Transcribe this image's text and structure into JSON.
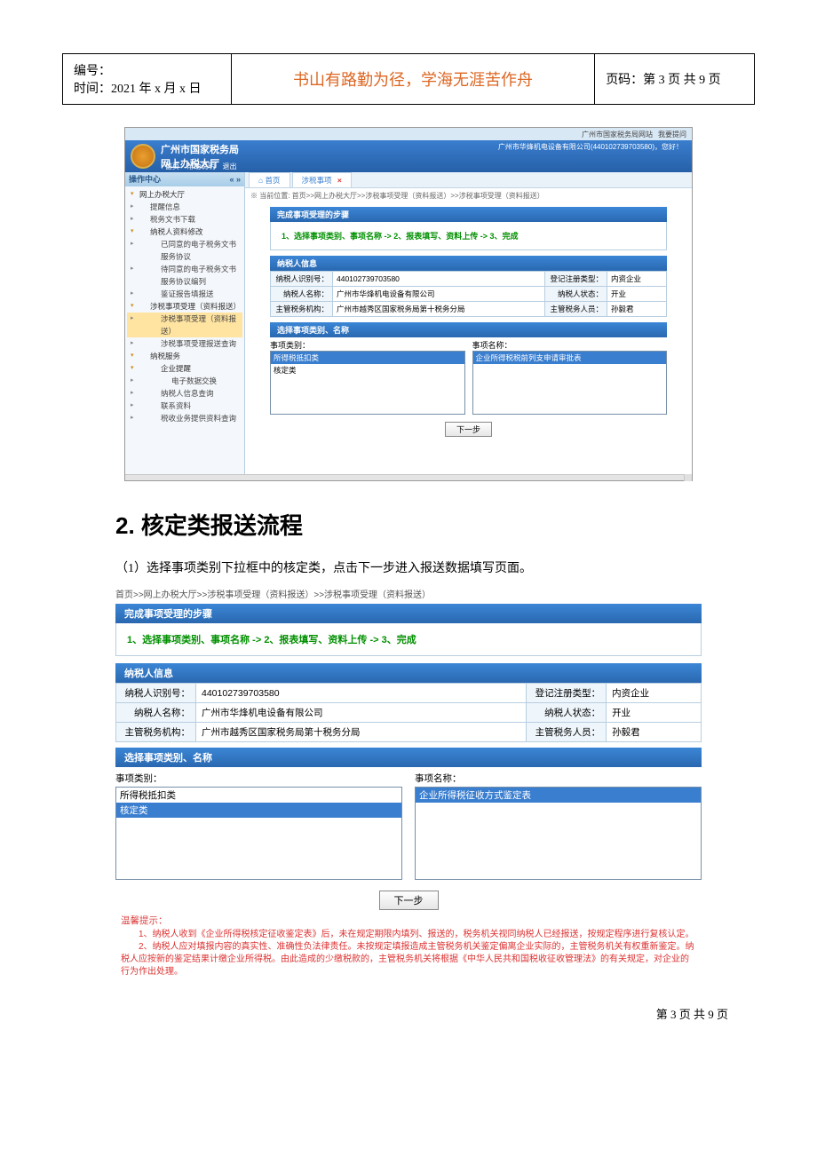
{
  "header": {
    "left_l1": "编号：",
    "left_l2": "时间：2021 年 x 月 x 日",
    "mid": "书山有路勤为径，学海无涯苦作舟",
    "right": "页码：第 3 页  共 9 页"
  },
  "emb": {
    "topbar_link1": "广州市国家税务局网站",
    "topbar_link2": "我要提问",
    "title": "广州市国家税务局",
    "subtitle": "网上办税大厅",
    "userline": "广州市华烽机电设备有限公司(440102739703580)，您好！",
    "nav_home": "首页",
    "nav_fav": "帮助说明",
    "nav_exit": "退出",
    "left_hd": "操作中心",
    "tree": [
      "网上办税大厅",
      "提醒信息",
      "税务文书下载",
      "纳税人资料修改",
      "已同意的电子税务文书服务协议",
      "待同意的电子税务文书服务协议编列",
      "鉴证报告填报送",
      "涉税事项受理（资料报送）",
      "涉税事项受理（资料报送）",
      "涉税事项受理报送查询",
      "纳税服务",
      "企业提醒",
      "电子数据交换",
      "纳税人信息查询",
      "联系资料",
      "税收业务提供资料查询"
    ],
    "tab_home": "首页",
    "tab_active": "涉税事项",
    "crumb": "※ 当前位置: 首页>>网上办税大厅>>涉税事项受理（资料报送）>>涉税事项受理（资料报送）",
    "step_hd": "完成事项受理的步骤",
    "steps": "1、选择事项类别、事项名称  ->  2、报表填写、资料上传  ->  3、完成",
    "info_hd": "纳税人信息",
    "info": {
      "id_lbl": "纳税人识别号：",
      "id_val": "440102739703580",
      "type_lbl": "登记注册类型：",
      "type_val": "内资企业",
      "name_lbl": "纳税人名称：",
      "name_val": "广州市华烽机电设备有限公司",
      "state_lbl": "纳税人状态：",
      "state_val": "开业",
      "org_lbl": "主管税务机构：",
      "org_val": "广州市越秀区国家税务局第十税务分局",
      "staff_lbl": "主管税务人员：",
      "staff_val": "孙毅君"
    },
    "select_hd": "选择事项类别、名称",
    "cat_lbl": "事项类别：",
    "name_lbl": "事项名称：",
    "cat_opts": [
      "所得税抵扣类",
      "核定类"
    ],
    "name_opts": [
      "企业所得税税前列支申请审批表"
    ],
    "next_btn": "下一步"
  },
  "section2": {
    "heading": "2. 核定类报送流程",
    "intro": "（1）选择事项类别下拉框中的核定类，点击下一步进入报送数据填写页面。"
  },
  "detail": {
    "crumb": "首页>>网上办税大厅>>涉税事项受理（资料报送）>>涉税事项受理（资料报送）",
    "step_hd": "完成事项受理的步骤",
    "steps": "1、选择事项类别、事项名称  ->  2、报表填写、资料上传  ->  3、完成",
    "info_hd": "纳税人信息",
    "select_hd": "选择事项类别、名称",
    "cat_lbl": "事项类别：",
    "name_lbl": "事项名称：",
    "cat_opts": [
      "所得税抵扣类",
      "核定类"
    ],
    "name_opts": [
      "企业所得税征收方式鉴定表"
    ],
    "next_btn": "下一步",
    "warm_hd": "温馨提示：",
    "warm_1": "1、纳税人收到《企业所得税核定征收鉴定表》后，未在规定期限内填列、报送的，税务机关视同纳税人已经报送，按规定程序进行复核认定。",
    "warm_2": "2、纳税人应对填报内容的真实性、准确性负法律责任。未按规定填报造成主管税务机关鉴定偏离企业实际的，主管税务机关有权重新鉴定。纳税人应按新的鉴定结果计缴企业所得税。由此造成的少缴税款的，主管税务机关将根据《中华人民共和国税收征收管理法》的有关规定，对企业的行为作出处理。"
  },
  "footer": "第  3  页  共  9  页"
}
